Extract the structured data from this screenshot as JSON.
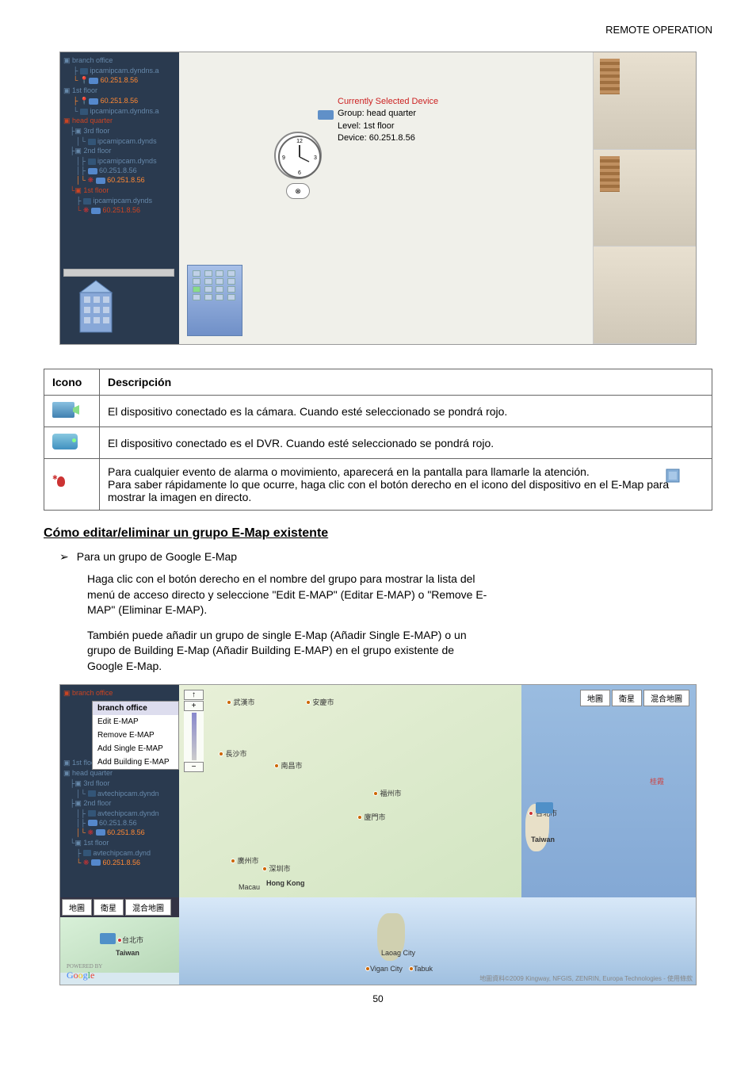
{
  "header": "REMOTE OPERATION",
  "screenshot1": {
    "tree": {
      "branch_office": "branch office",
      "ipcam_dyn": "ipcamipcam.dyndns.a",
      "ip1": "60.251.8.56",
      "first_floor": "1st floor",
      "ip2": "60.251.8.56",
      "ipcam2": "ipcamipcam.dyndns.a",
      "head_quarter": "head quarter",
      "third_floor": "3rd floor",
      "ipcam3": "ipcamipcam.dynds",
      "second_floor": "2nd floor",
      "ipcam4": "ipcamipcam.dynds",
      "ip3": "60.251.8.56",
      "ip4": "60.251.8.56",
      "first_floor2": "1st floor",
      "ipcam5": "ipcamipcam.dynds",
      "ip5": "60.251.8.56"
    },
    "selected": {
      "title": "Currently Selected Device",
      "group": "Group: head quarter",
      "level": "Level: 1st floor",
      "device": "Device: 60.251.8.56"
    }
  },
  "table": {
    "header_icon": "Icono",
    "header_desc": "Descripción",
    "row1": "El dispositivo conectado es la cámara. Cuando esté seleccionado se pondrá rojo.",
    "row2": "El dispositivo conectado es el DVR. Cuando esté seleccionado se pondrá rojo.",
    "row3": "Para cualquier evento de alarma o movimiento, aparecerá en la pantalla para llamarle la atención.\nPara saber rápidamente lo que ocurre, haga clic con el botón derecho en el icono del dispositivo en el E-Map para mostrar la imagen en directo."
  },
  "section": {
    "title": "Cómo editar/eliminar un grupo E-Map existente",
    "bullet": "Para un grupo de Google E-Map",
    "para1": "Haga clic con el botón derecho en el nombre del grupo para mostrar la lista del menú de acceso directo y seleccione \"Edit E-MAP\" (Editar E-MAP) o \"Remove E-MAP\" (Eliminar E-MAP).",
    "para2": "También puede añadir un grupo de single E-Map (Añadir Single E-MAP) o un grupo de Building E-Map (Añadir Building E-MAP) en el grupo existente de Google E-Map."
  },
  "screenshot2": {
    "tree": {
      "branch_office": "branch office",
      "first_floor": "1st floor",
      "head_quarter": "head quarter",
      "third_floor": "3rd floor",
      "avtech1": "avtechipcam.dyndn",
      "second_floor": "2nd floor",
      "avtech2": "avtechipcam.dyndn",
      "ip1": "60.251.8.56",
      "ip2": "60.251.8.56",
      "first_floor2": "1st floor",
      "avtech3": "avtechipcam.dynd",
      "ip3": "60.251.8.56"
    },
    "menu": {
      "header": "branch office",
      "edit": "Edit E-MAP",
      "remove": "Remove E-MAP",
      "add_single": "Add Single E-MAP",
      "add_building": "Add Building E-MAP"
    },
    "map_buttons": {
      "b1": "地圖",
      "b2": "衛星",
      "b3": "混合地圖"
    },
    "cities": {
      "wuhan": "武漢市",
      "anqing": "安慶市",
      "changsha": "長沙市",
      "nanchang": "南昌市",
      "fuzhou": "福州市",
      "xiamen": "廈門市",
      "taipei": "台北市",
      "taiwan": "Taiwan",
      "hongkong": "Hong Kong",
      "macau": "Macau",
      "guangzhou": "廣州市",
      "shenzhen": "深圳市"
    },
    "bottom": {
      "b1": "地圖",
      "b2": "衛星",
      "b3": "混合地圖",
      "taipei": "台北市",
      "taiwan": "Taiwan",
      "laoag": "Laoag City",
      "vigan": "Vigan City",
      "tabuk": "Tabuk"
    },
    "copyright": "地圖資料©2009 Kingway, NFGIS, ZENRIN, Europa Technologies - 使用條款"
  },
  "page_number": "50"
}
